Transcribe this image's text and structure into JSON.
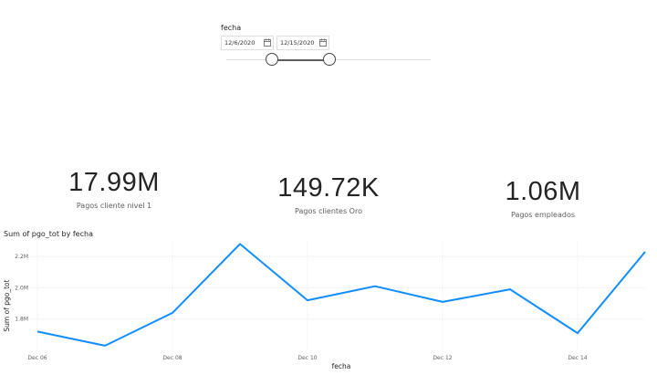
{
  "slicer": {
    "title": "fecha",
    "start_date": "12/6/2020",
    "end_date": "12/15/2020",
    "calendar_icon": "calendar-icon"
  },
  "cards": [
    {
      "value": "17.99M",
      "label": "Pagos cliente nivel 1"
    },
    {
      "value": "149.72K",
      "label": "Pagos clientes Oro"
    },
    {
      "value": "1.06M",
      "label": "Pagos empleados"
    }
  ],
  "chart_data": {
    "type": "line",
    "title": "Sum of pgo_tot by fecha",
    "xlabel": "fecha",
    "ylabel": "Sum of pgo_tot",
    "x": [
      "Dec 06",
      "Dec 07",
      "Dec 08",
      "Dec 09",
      "Dec 10",
      "Dec 11",
      "Dec 12",
      "Dec 13",
      "Dec 14",
      "Dec 15"
    ],
    "x_tick_labels": [
      "Dec 06",
      "Dec 08",
      "Dec 10",
      "Dec 12",
      "Dec 14"
    ],
    "values": [
      1.72,
      1.63,
      1.84,
      2.28,
      1.92,
      2.01,
      1.91,
      1.99,
      1.71,
      2.23
    ],
    "y_tick_labels": [
      "1.8M",
      "2.0M",
      "2.2M"
    ],
    "y_ticks": [
      1.8,
      2.0,
      2.2
    ],
    "ylim": [
      1.6,
      2.3
    ],
    "grid": true,
    "line_color": "#118DFF"
  }
}
